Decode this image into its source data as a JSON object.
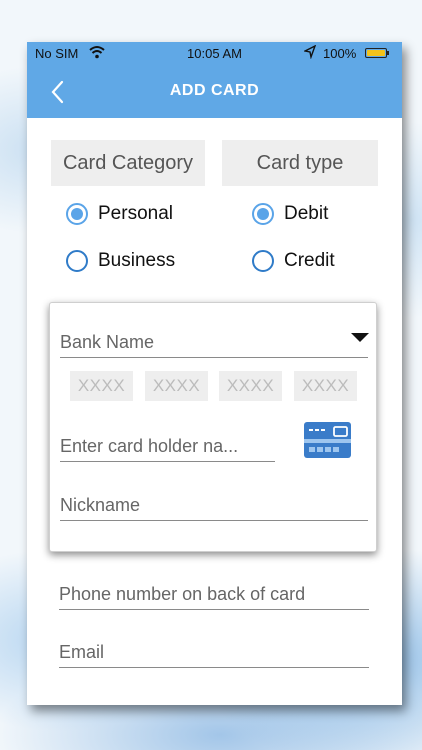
{
  "status_bar": {
    "carrier": "No SIM",
    "time": "10:05 AM",
    "battery": "100%",
    "battery_level": 1.0
  },
  "nav": {
    "title": "ADD CARD",
    "back_icon": "chevron-left-icon"
  },
  "card_category": {
    "label": "Card Category",
    "options": [
      {
        "label": "Personal",
        "selected": true
      },
      {
        "label": "Business",
        "selected": false
      }
    ]
  },
  "card_type": {
    "label": "Card type",
    "options": [
      {
        "label": "Debit",
        "selected": true
      },
      {
        "label": "Credit",
        "selected": false
      }
    ]
  },
  "form": {
    "bank_name_placeholder": "Bank Name",
    "card_number_placeholders": [
      "XXXX",
      "XXXX",
      "XXXX",
      "XXXX"
    ],
    "holder_name_placeholder": "Enter card holder na...",
    "nickname_placeholder": "Nickname",
    "phone_placeholder": "Phone number on back of card",
    "email_placeholder": "Email"
  },
  "colors": {
    "accent": "#60a8e6",
    "radio_selected": "#5aa4e8",
    "radio_border": "#2f7bc8",
    "card_icon": "#3a7cc9"
  }
}
